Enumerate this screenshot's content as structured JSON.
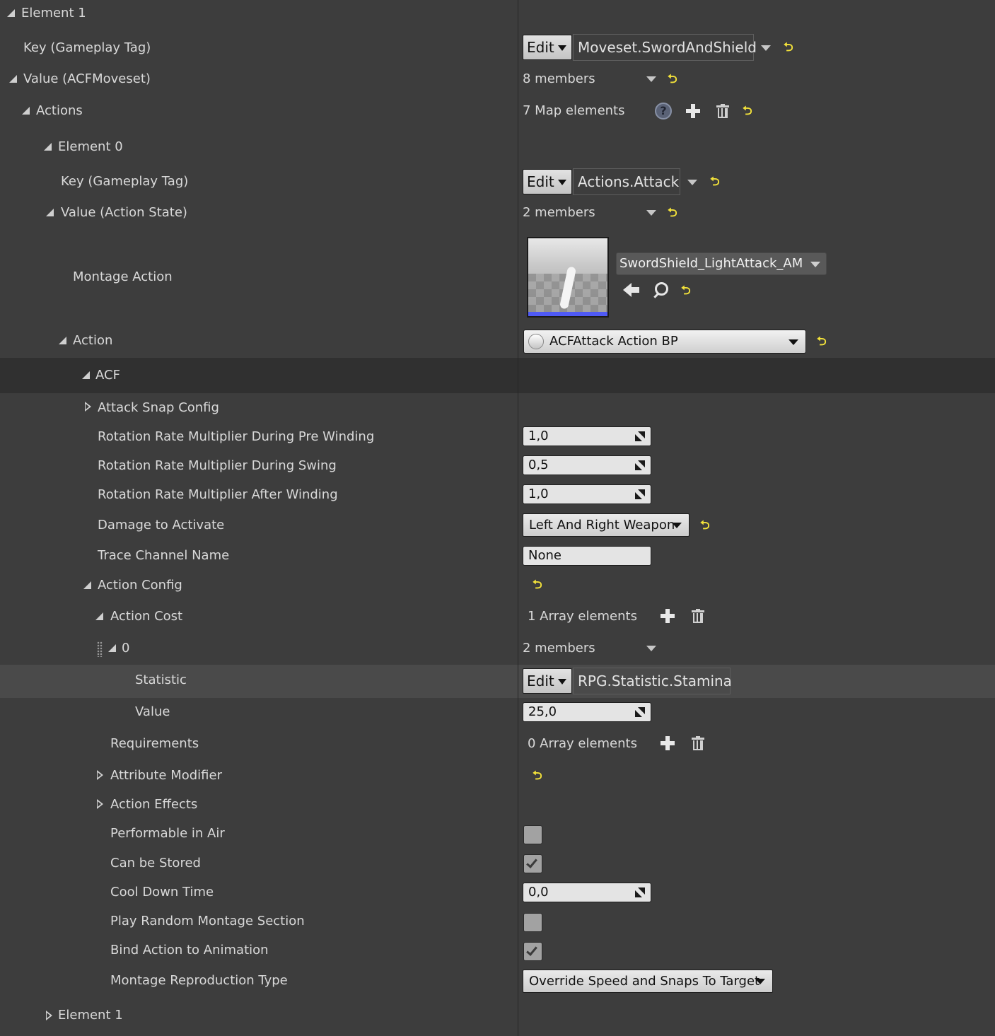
{
  "rows": {
    "element1_top": "Element 1",
    "key_tag_1": "Key (Gameplay Tag)",
    "value_moveset": "Value (ACFMoveset)",
    "actions": "Actions",
    "element0": "Element 0",
    "key_tag_0": "Key (Gameplay Tag)",
    "value_action_state": "Value (Action State)",
    "montage_action": "Montage Action",
    "action": "Action",
    "acf": "ACF",
    "attack_snap_config": "Attack Snap Config",
    "rot_pre_winding": "Rotation Rate Multiplier During Pre Winding",
    "rot_during_swing": "Rotation Rate Multiplier During Swing",
    "rot_after_winding": "Rotation Rate Multiplier After Winding",
    "damage_to_activate": "Damage to Activate",
    "trace_channel_name": "Trace Channel Name",
    "action_config": "Action Config",
    "action_cost": "Action Cost",
    "index0": "0",
    "statistic": "Statistic",
    "value": "Value",
    "requirements": "Requirements",
    "attribute_modifier": "Attribute Modifier",
    "action_effects": "Action Effects",
    "performable_in_air": "Performable in Air",
    "can_be_stored": "Can be Stored",
    "cool_down_time": "Cool Down Time",
    "play_random_montage_section": "Play Random Montage Section",
    "bind_action_to_animation": "Bind Action to Animation",
    "montage_reproduction_type": "Montage Reproduction Type",
    "element1_bottom": "Element 1"
  },
  "values": {
    "edit_label": "Edit",
    "moveset_tag": "Moveset.SwordAndShield",
    "moveset_members": "8 members",
    "map_elements": "7 Map elements",
    "action_tag": "Actions.Attack",
    "action_state_members": "2 members",
    "montage_asset": "SwordShield_LightAttack_AM",
    "action_class": "ACFAttack Action BP",
    "rot_pre_winding": "1,0",
    "rot_during_swing": "0,5",
    "rot_after_winding": "1,0",
    "damage_to_activate": "Left And Right Weapon",
    "trace_channel_name": "None",
    "action_cost_count": "1 Array elements",
    "cost0_members": "2 members",
    "statistic_tag": "RPG.Statistic.Stamina",
    "cost_value": "25,0",
    "requirements_count": "0 Array elements",
    "performable_in_air": false,
    "can_be_stored": true,
    "cool_down_time": "0,0",
    "play_random_montage_section": false,
    "bind_action_to_animation": true,
    "montage_reproduction_type": "Override Speed and Snaps To Target"
  },
  "icons": {
    "reset": "reset-to-default-icon",
    "help": "help-icon",
    "add": "plus-icon",
    "delete": "trash-icon",
    "browse": "back-arrow-icon",
    "find": "magnifier-icon"
  },
  "colors": {
    "background": "#3d3d3d",
    "reset_icon": "#f3e23a",
    "thumbnail_bar": "#4f5af5"
  }
}
